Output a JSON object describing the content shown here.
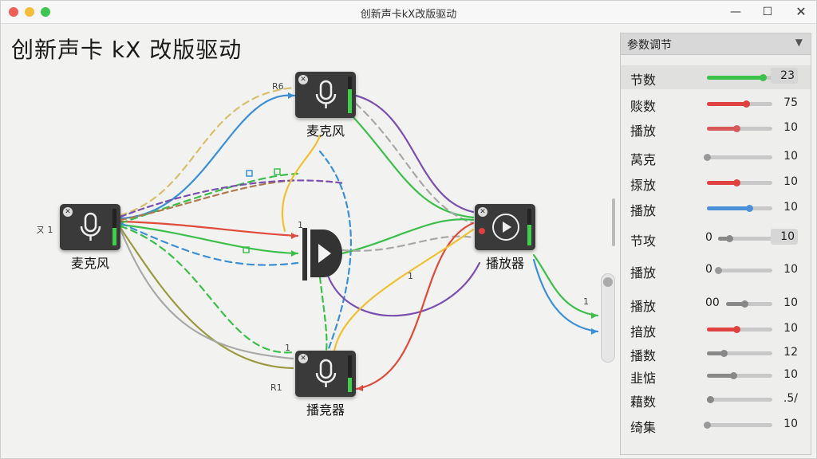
{
  "window": {
    "title": "创新声卡kX改版驱动"
  },
  "page": {
    "title": "创新声卡 kX 改版驱动"
  },
  "nodes": [
    {
      "id": "mic-top",
      "label": "麦克风",
      "type": "mic",
      "tag": "R6"
    },
    {
      "id": "mic-left",
      "label": "麦克风",
      "type": "mic",
      "tag": "ㄡ 1"
    },
    {
      "id": "player-right",
      "label": "播放器",
      "type": "player",
      "tag": ""
    },
    {
      "id": "mic-bottom",
      "label": "播竞器",
      "type": "mic",
      "tag": "R1"
    }
  ],
  "canvas_marks": {
    "hub_tag": "1",
    "bottom_tag": "1",
    "right_tag": "1",
    "mid_tag": "1"
  },
  "panel": {
    "title": "参数调节",
    "params": [
      {
        "label": "节数",
        "value": "23",
        "prefix": "",
        "level": 0.85,
        "color": "#3cc24a",
        "boxed": true,
        "highlight": true
      },
      {
        "label": "赕数",
        "value": "75",
        "prefix": "",
        "level": 0.6,
        "color": "#e04040",
        "boxed": false,
        "highlight": false
      },
      {
        "label": "播放",
        "value": "10",
        "prefix": "",
        "level": 0.45,
        "color": "#d85a5a",
        "boxed": false,
        "highlight": false
      },
      {
        "label": "莴克",
        "value": "10",
        "prefix": "",
        "level": 0.0,
        "color": "#999999",
        "boxed": false,
        "highlight": false
      },
      {
        "label": "揼放",
        "value": "10",
        "prefix": "",
        "level": 0.45,
        "color": "#e04040",
        "boxed": false,
        "highlight": false
      },
      {
        "label": "播放",
        "value": "10",
        "prefix": "",
        "level": 0.65,
        "color": "#4a90d9",
        "boxed": false,
        "highlight": false
      },
      {
        "label": "节攻",
        "value": "10",
        "prefix": "0",
        "level": 0.2,
        "color": "#888888",
        "boxed": true,
        "highlight": false
      },
      {
        "label": "播放",
        "value": "10",
        "prefix": "0",
        "level": 0.0,
        "color": "#999999",
        "boxed": false,
        "highlight": false
      },
      {
        "label": "播放",
        "value": "10",
        "prefix": "00",
        "level": 0.4,
        "color": "#888888",
        "boxed": false,
        "highlight": false
      },
      {
        "label": "揞放",
        "value": "10",
        "prefix": "",
        "level": 0.45,
        "color": "#e04040",
        "boxed": false,
        "highlight": false
      },
      {
        "label": "播数",
        "value": "12",
        "prefix": "",
        "level": 0.25,
        "color": "#888888",
        "boxed": false,
        "highlight": false
      },
      {
        "label": "韭惦",
        "value": "10",
        "prefix": "",
        "level": 0.4,
        "color": "#888888",
        "boxed": false,
        "highlight": false
      },
      {
        "label": "藉数",
        "value": ".5/",
        "prefix": "",
        "level": 0.05,
        "color": "#888888",
        "boxed": false,
        "highlight": false
      },
      {
        "label": "绮集",
        "value": "10",
        "prefix": "",
        "level": 0.0,
        "color": "#999999",
        "boxed": false,
        "highlight": false
      }
    ]
  },
  "colors": {
    "red": "#e04a3a",
    "green": "#3cbf4a",
    "blue": "#3a8fd6",
    "yellow": "#f0c030",
    "purple": "#7a4fb0",
    "olive": "#9a9a40",
    "gray": "#a8a8a8",
    "tan": "#d9bf6a",
    "brown": "#b07a50"
  },
  "icons": [
    "microphone-icon",
    "play-icon",
    "close-icon",
    "chevron-down-icon",
    "minimize-icon",
    "maximize-icon"
  ]
}
